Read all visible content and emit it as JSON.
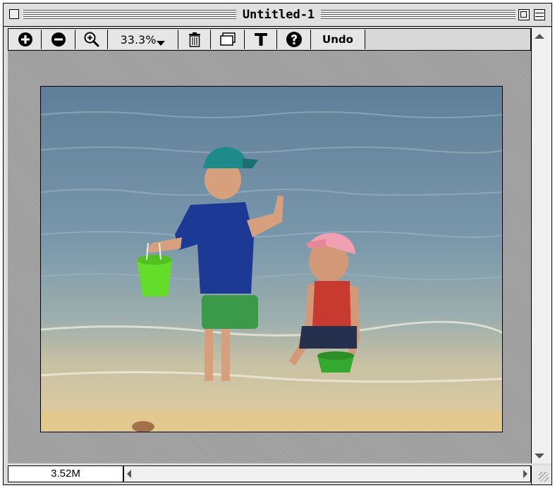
{
  "window": {
    "title": "Untitled-1"
  },
  "toolbar": {
    "zoom_in_icon": "plus-circle",
    "zoom_out_icon": "minus-circle",
    "magnify_icon": "magnifier-plus",
    "zoom_value": "33.3%",
    "trash_icon": "trash-can",
    "frame_icon": "frame",
    "text_icon": "T",
    "help_icon": "question-circle",
    "undo_label": "Undo"
  },
  "status": {
    "file_size": "3.52M"
  },
  "image": {
    "description_icon": "beach-photo"
  },
  "colors": {
    "window_bg": "#dcdcdc",
    "canvas_bg": "#a0a0a0",
    "sea": "#6f90a6",
    "sand": "#e2c98f"
  }
}
